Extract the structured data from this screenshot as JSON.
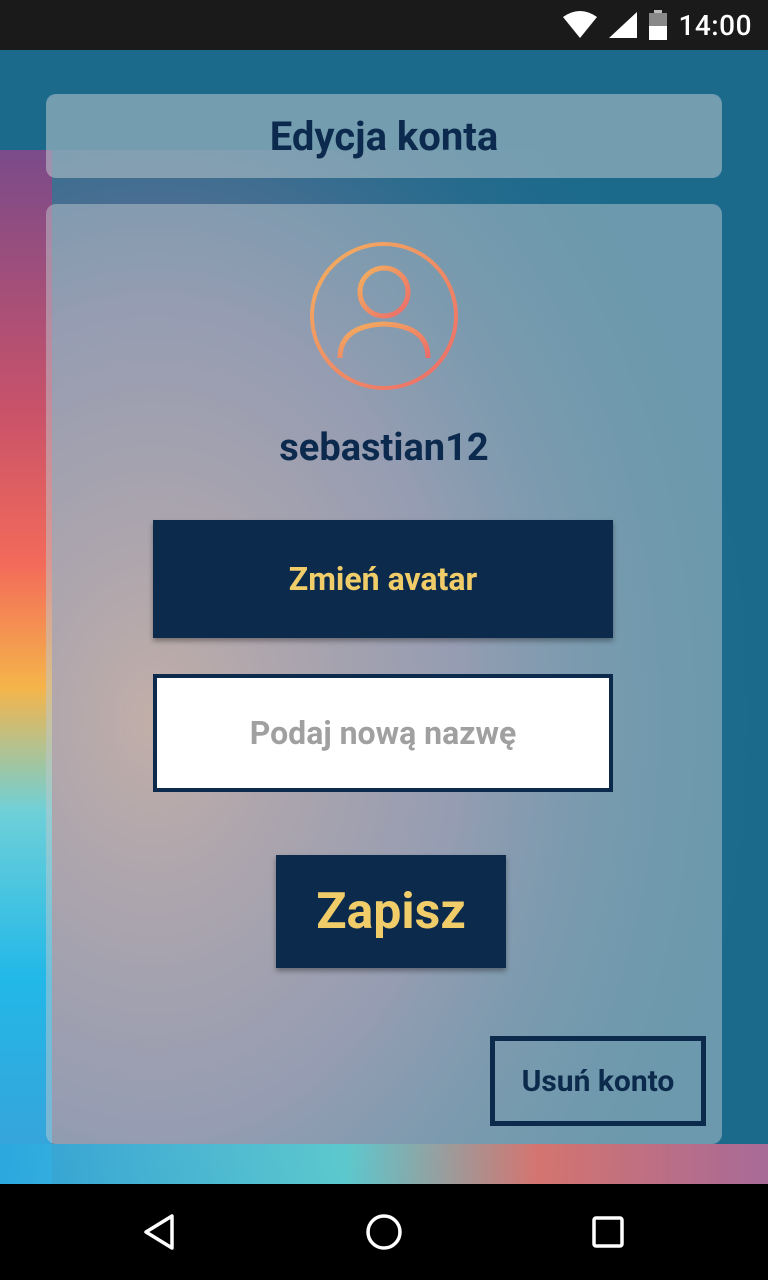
{
  "status_bar": {
    "time": "14:00"
  },
  "header": {
    "title": "Edycja konta"
  },
  "profile": {
    "username": "sebastian12"
  },
  "actions": {
    "change_avatar_label": "Zmień avatar",
    "new_name_placeholder": "Podaj nową nazwę",
    "new_name_value": "",
    "save_label": "Zapisz",
    "delete_account_label": "Usuń konto"
  },
  "colors": {
    "primary_dark": "#0c2a4c",
    "button_text": "#f1cd6a",
    "background": "#1b6a8c",
    "avatar_gradient_start": "#f3b25e",
    "avatar_gradient_end": "#ec6a6a"
  },
  "icons": {
    "avatar": "user-circle-icon",
    "wifi": "wifi-icon",
    "signal": "signal-icon",
    "battery": "battery-icon",
    "back": "back-triangle-icon",
    "home": "home-circle-icon",
    "recents": "recents-square-icon"
  }
}
